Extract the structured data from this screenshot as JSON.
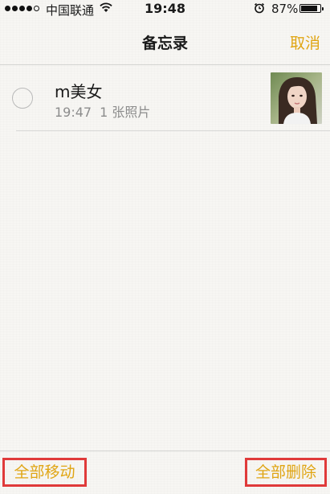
{
  "status_bar": {
    "carrier": "中国联通",
    "time": "19:48",
    "battery_percent": "87%",
    "battery_level": 0.87,
    "signal_bars_filled": 4,
    "signal_bars_total": 5
  },
  "nav": {
    "title": "备忘录",
    "cancel_label": "取消"
  },
  "notes": [
    {
      "title": "m美女",
      "time": "19:47",
      "attachment": "1 张照片",
      "selected": false
    }
  ],
  "toolbar": {
    "move_all_label": "全部移动",
    "delete_all_label": "全部删除"
  },
  "colors": {
    "accent": "#e0a513",
    "highlight_box": "#e03a3a",
    "background": "#f7f6f3"
  },
  "icons": {
    "signal": "signal-dots-icon",
    "wifi": "wifi-icon",
    "alarm": "alarm-clock-icon",
    "battery": "battery-icon",
    "select": "circle-checkbox-icon"
  }
}
